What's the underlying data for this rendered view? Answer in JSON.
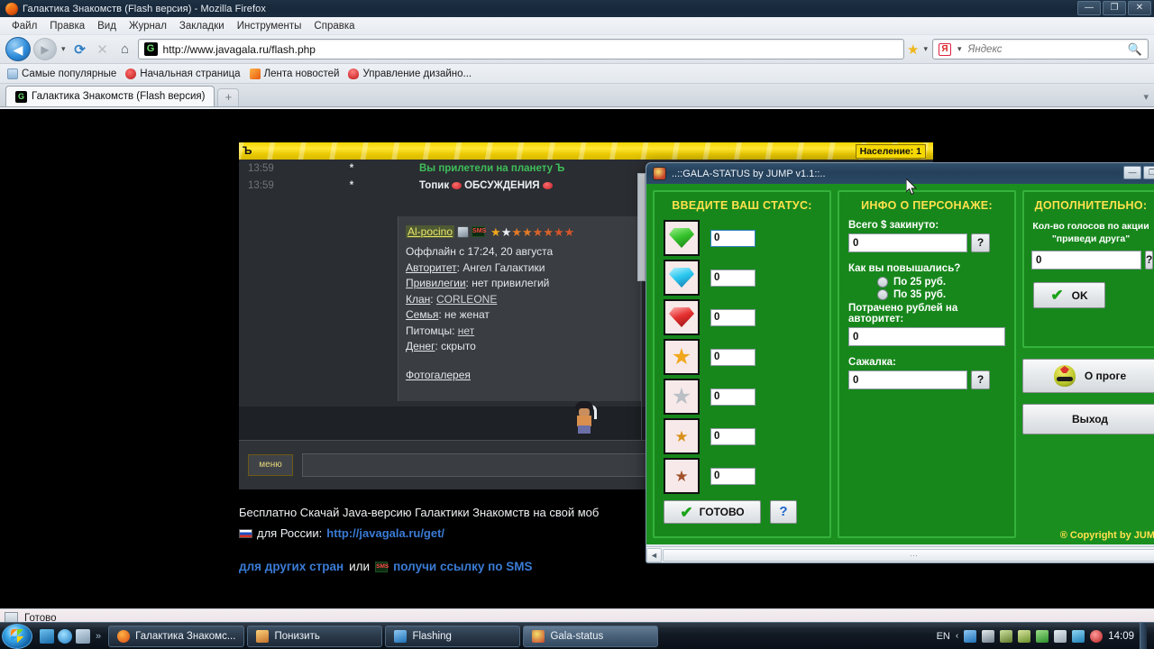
{
  "browser": {
    "window_title": "Галактика Знакомств (Flash версия) - Mozilla Firefox",
    "menu": [
      "Файл",
      "Правка",
      "Вид",
      "Журнал",
      "Закладки",
      "Инструменты",
      "Справка"
    ],
    "url": "http://www.javagala.ru/flash.php",
    "search_placeholder": "Яндекс",
    "search_value": "",
    "bookmarks": [
      {
        "label": "Самые популярные",
        "icon": "bookmark-page-icon"
      },
      {
        "label": "Начальная страница",
        "icon": "firefox-home-icon"
      },
      {
        "label": "Лента новостей",
        "icon": "rss-feed-icon"
      },
      {
        "label": "Управление дизайно...",
        "icon": "design-manage-icon"
      }
    ],
    "tab": {
      "title": "Галактика Знакомств (Flash версия)",
      "favicon": "gala-favicon"
    },
    "new_tab_label": "+",
    "window_buttons": {
      "minimize": "—",
      "maximize": "❐",
      "close": "✕"
    },
    "status_text": "Готово"
  },
  "game": {
    "planet_label": "Ъ",
    "population_badge": "Население: 1",
    "chat": [
      {
        "time": "13:59",
        "marker": "*",
        "message": "Вы прилетели на планету Ъ",
        "color": "green"
      },
      {
        "time": "13:59",
        "marker": "*",
        "message_prefix": "Топик",
        "message_suffix": "ОБСУЖДЕНИЯ",
        "color": "white"
      }
    ],
    "profile": {
      "name": "Al-pocino",
      "status_line": "Оффлайн с 17:24, 20 августа",
      "fields": [
        {
          "key": "Авторитет",
          "value": "Ангел Галактики"
        },
        {
          "key": "Привилегии",
          "value": "нет привилегий"
        },
        {
          "key": "Клан",
          "value": "CORLEONE"
        },
        {
          "key": "Семья",
          "value": "не женат"
        },
        {
          "key": "Питомцы",
          "value": "нет"
        },
        {
          "key": "Денег",
          "value": "скрыто"
        }
      ],
      "gallery_link": "Фотогалерея",
      "stars": [
        "gold",
        "silver",
        "gold",
        "gold",
        "gold",
        "gold",
        "gold",
        "gold"
      ]
    },
    "menu_button": "меню",
    "chat_input_value": "",
    "promo": {
      "line1": "Бесплатно Скачай Java-версию Галактики Знакомств на свой моб",
      "line2_prefix": "для России:",
      "line2_link": "http://javagala.ru/get/",
      "line3_bold": "для других стран",
      "line3_or": "или",
      "line3_tail": "получи ссылку по SMS"
    }
  },
  "dialog": {
    "title": "..::GALA-STATUS by JUMP v1.1::..",
    "window_buttons": {
      "minimize": "—",
      "maximize": "❐"
    },
    "left_panel": {
      "title": "ВВЕДИТЕ ВАШ СТАТУС:",
      "rows": [
        {
          "icon": "green-gem-icon",
          "value": "0"
        },
        {
          "icon": "blue-gem-icon",
          "value": "0"
        },
        {
          "icon": "red-gem-icon",
          "value": "0"
        },
        {
          "icon": "gold-star-icon",
          "value": "0"
        },
        {
          "icon": "silver-star-icon",
          "value": "0"
        },
        {
          "icon": "small-gold-star-icon",
          "value": "0"
        },
        {
          "icon": "small-bronze-star-icon",
          "value": "0"
        }
      ],
      "done_button": "ГОТОВО",
      "help_button": "?"
    },
    "middle_panel": {
      "title": "ИНФО О ПЕРСОНАЖЕ:",
      "total_label": "Всего $ закинуто:",
      "total_value": "0",
      "total_help": "?",
      "raise_question": "Как вы повышались?",
      "radio_options": [
        {
          "label": "По 25 руб.",
          "selected": false
        },
        {
          "label": "По 35 руб.",
          "selected": false
        }
      ],
      "spent_label": "Потрачено рублей на авторитет:",
      "spent_value": "0",
      "planter_label": "Сажалка:",
      "planter_value": "0",
      "planter_help": "?"
    },
    "right_panel": {
      "title": "ДОПОЛНИТЕЛЬНО:",
      "refer_label_line1": "Кол-во голосов по акции",
      "refer_label_line2": "\"приведи друга\"",
      "refer_value": "0",
      "refer_help": "?",
      "ok_button": "OK",
      "about_button": "О проге",
      "exit_button": "Выход",
      "copyright": "® Copyright by JUM"
    },
    "scroll": {
      "left_arrow": "◄",
      "thumb_grip": "⋯"
    }
  },
  "taskbar": {
    "start_label": "start-orb",
    "quick_launch": [
      "media-player-icon",
      "internet-explorer-icon",
      "show-desktop-icon"
    ],
    "overflow": "»",
    "tasks": [
      {
        "label": "Галактика Знакомс...",
        "icon": "firefox-icon",
        "active": false
      },
      {
        "label": "Понизить",
        "icon": "app-icon",
        "active": false
      },
      {
        "label": "Flashing",
        "icon": "flash-icon",
        "active": false
      },
      {
        "label": "Gala-status",
        "icon": "gala-status-icon",
        "active": true
      }
    ],
    "tray": {
      "language": "EN",
      "chevron": "‹",
      "icons": [
        "contacts-icon",
        "kaspersky-icon",
        "webcam-icon",
        "monitor-icon",
        "update-icon",
        "battery-icon",
        "network-icon",
        "volume-icon"
      ],
      "clock": "14:09"
    }
  },
  "colors": {
    "dialog_green": "#17871c",
    "dialog_border_green": "#35b23b",
    "panel_title_yellow": "#ffe14d",
    "gala_yellow": "#f2d400",
    "chat_green": "#3fbf5a",
    "link_blue": "#3a7bd5",
    "taskbar_dark": "#121a24"
  }
}
